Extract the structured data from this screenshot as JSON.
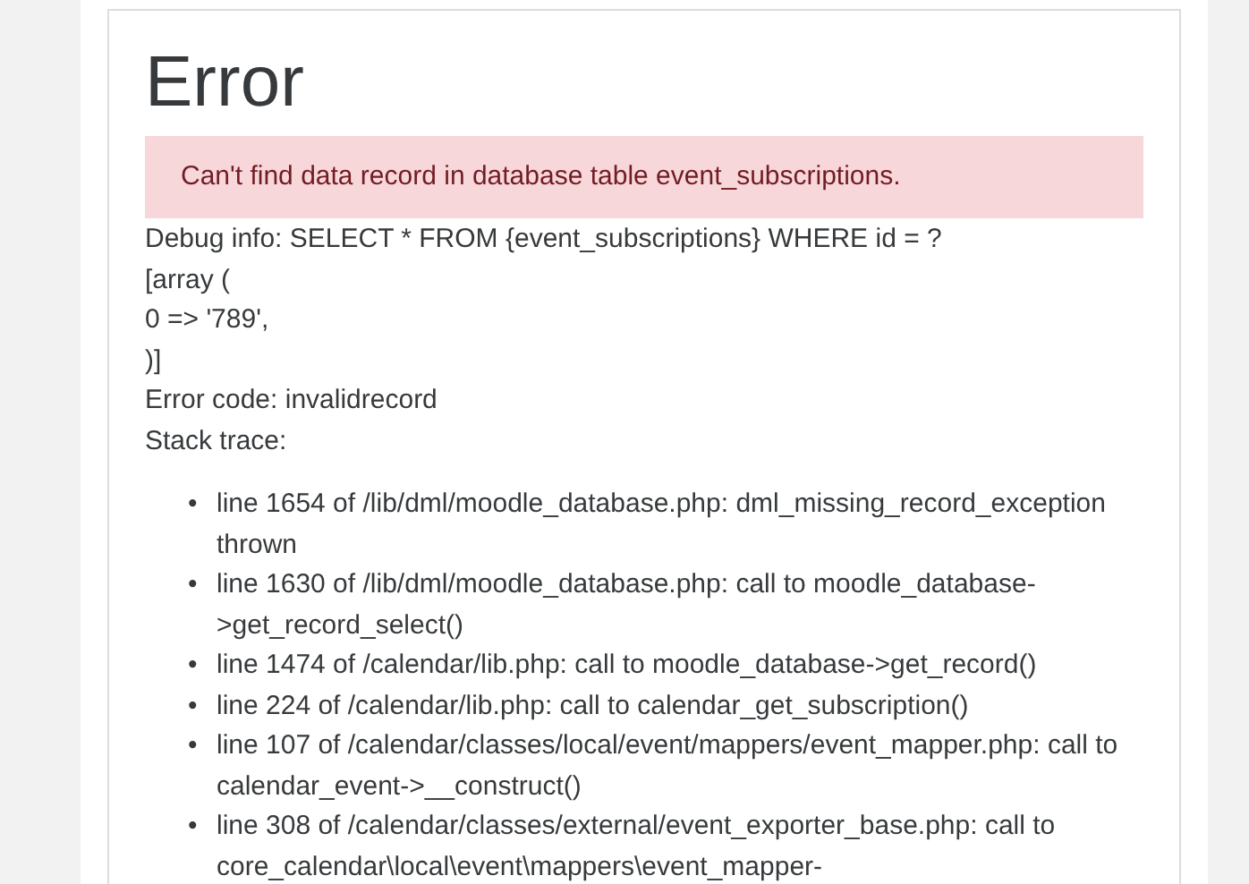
{
  "heading": "Error",
  "alert": "Can't find data record in database table event_subscriptions.",
  "debug_lines": [
    "Debug info: SELECT * FROM {event_subscriptions} WHERE id = ?",
    "[array (",
    "0 => '789',",
    ")]",
    "Error code: invalidrecord",
    "Stack trace:"
  ],
  "stack_trace": [
    {
      "marker": "•",
      "text": "line 1654 of /lib/dml/moodle_database.php: dml_missing_record_exception thrown"
    },
    {
      "marker": "•",
      "text": "line 1630 of /lib/dml/moodle_database.php: call to moodle_database->get_record_select()"
    },
    {
      "marker": "•",
      "text": "line 1474 of /calendar/lib.php: call to moodle_database->get_record()"
    },
    {
      "marker": "•",
      "text": "line 224 of /calendar/lib.php: call to calendar_get_subscription()"
    },
    {
      "marker": "•",
      "text": "line 107 of /calendar/classes/local/event/mappers/event_mapper.php: call to calendar_event->__construct()"
    },
    {
      "marker": "•",
      "text": "line 308 of /calendar/classes/external/event_exporter_base.php: call to core_calendar\\local\\event\\mappers\\event_mapper-"
    }
  ]
}
